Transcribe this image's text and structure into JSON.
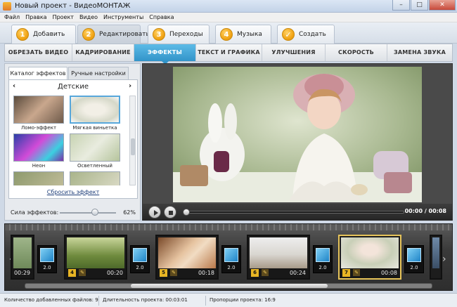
{
  "window": {
    "title": "Новый проект - ВидеоМОНТАЖ",
    "minimize": "–",
    "maximize": "□",
    "close": "✕"
  },
  "menu": [
    "Файл",
    "Правка",
    "Проект",
    "Видео",
    "Инструменты",
    "Справка"
  ],
  "steps": [
    {
      "num": "1",
      "label": "Добавить"
    },
    {
      "num": "2",
      "label": "Редактировать"
    },
    {
      "num": "3",
      "label": "Переходы"
    },
    {
      "num": "4",
      "label": "Музыка"
    },
    {
      "num": "",
      "label": "Создать"
    }
  ],
  "subtabs": [
    "ОБРЕЗАТЬ ВИДЕО",
    "КАДРИРОВАНИЕ",
    "ЭФФЕКТЫ",
    "ТЕКСТ И ГРАФИКА",
    "УЛУЧШЕНИЯ",
    "СКОРОСТЬ",
    "ЗАМЕНА ЗВУКА"
  ],
  "left_panel": {
    "tabs": [
      "Каталог эффектов",
      "Ручные настройки"
    ],
    "category": "Детские",
    "prev": "‹",
    "next": "›",
    "effects": [
      {
        "name": "Ломо-эффект"
      },
      {
        "name": "Мягкая виньетка"
      },
      {
        "name": "Неон"
      },
      {
        "name": "Осветленный"
      },
      {
        "name": ""
      },
      {
        "name": ""
      }
    ],
    "reset": "Сбросить эффект",
    "strength_label": "Сила эффектов:",
    "strength_value": "62%",
    "strength_fraction": 0.62
  },
  "player": {
    "timecode": "00:00 / 00:08",
    "progress": 0.0
  },
  "timeline": {
    "prev": "‹",
    "next": "›",
    "clips": [
      {
        "num": "",
        "time": "00:29",
        "pen": ""
      },
      {
        "num": "4",
        "time": "00:20",
        "pen": "✎"
      },
      {
        "num": "5",
        "time": "00:18",
        "pen": "✎"
      },
      {
        "num": "6",
        "time": "00:24",
        "pen": "✎"
      },
      {
        "num": "7",
        "time": "00:08",
        "pen": "✎"
      }
    ],
    "transitions": [
      "2.0",
      "2.0",
      "2.0",
      "2.0",
      "2.0"
    ]
  },
  "status": {
    "files": "Количество добавленных файлов: 9",
    "duration": "Длительность проекта: 00:03:01",
    "ratio": "Пропорции проекта: 16:9"
  },
  "colors": {
    "accent": "#3294c9",
    "step_badge": "#f2a516",
    "clip_selected": "#e7c45a"
  }
}
